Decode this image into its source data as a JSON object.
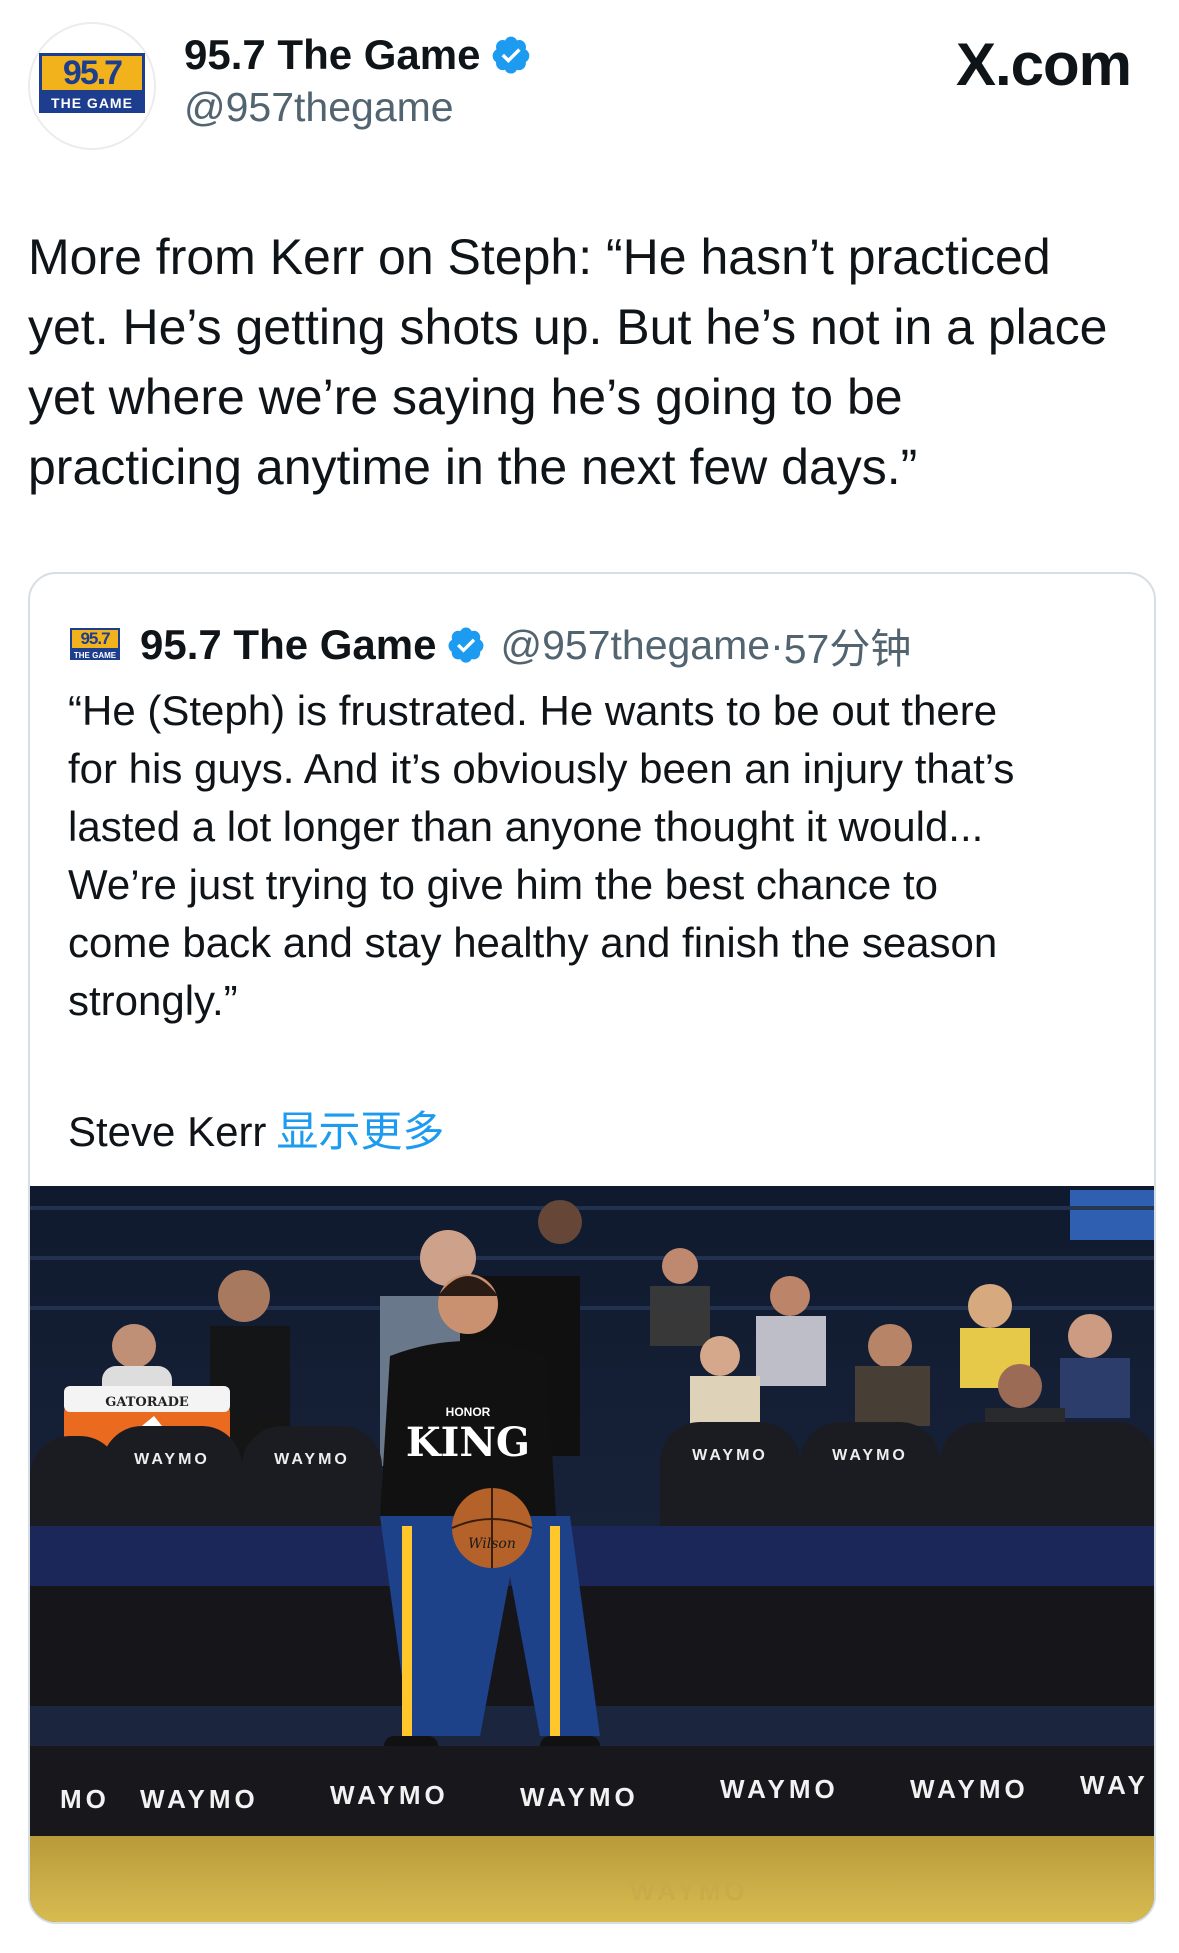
{
  "header": {
    "avatar_logo_top": "95.7",
    "avatar_logo_bottom": "THE GAME",
    "display_name": "95.7 The Game",
    "handle": "@957thegame",
    "site": "X.com"
  },
  "tweet": {
    "text": "More from Kerr on Steph: “He hasn’t practiced\nyet. He’s getting shots up. But he’s not in a place\nyet where we’re saying he’s going to be\npracticing anytime in the next few days.”"
  },
  "quote": {
    "logo_top": "95.7",
    "logo_bottom": "THE GAME",
    "display_name": "95.7 The Game",
    "handle": "@957thegame",
    "separator": "·",
    "time": "57分钟",
    "text": "“He (Steph) is frustrated. He wants to be out there\nfor his guys. And it’s obviously been an injury that’s\nlasted a lot longer than anyone thought it would...\nWe’re just trying to give him the best chance to\ncome back and stay healthy and finish the season\nstrongly.”",
    "author": "Steve Kerr",
    "show_more": "显示更多"
  },
  "photo": {
    "cooler_label": "GATORADE",
    "shirt_text_1": "HONOR",
    "shirt_text_2": "KING",
    "ball_text": "Wilson",
    "sponsor": "WAYMO",
    "floor_text": "WAYMO"
  },
  "colors": {
    "verified": "#1d9bf0",
    "link": "#1d9bf0",
    "secondary_text": "#536471",
    "jersey_blue": "#1d428a",
    "jersey_gold": "#ffc72c"
  }
}
